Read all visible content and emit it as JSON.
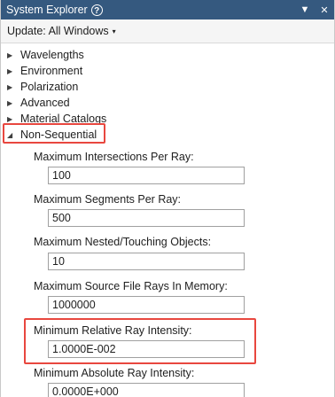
{
  "window": {
    "title": "System Explorer",
    "help_glyph": "?",
    "dropdown_glyph": "▼",
    "close_glyph": "✕"
  },
  "toolbar": {
    "update_label": "Update: All Windows",
    "caret": "▾"
  },
  "tree": {
    "collapsed_glyph": "▶",
    "expanded_glyph": "◢",
    "items": [
      {
        "label": "Wavelengths"
      },
      {
        "label": "Environment"
      },
      {
        "label": "Polarization"
      },
      {
        "label": "Advanced"
      },
      {
        "label": "Material Catalogs"
      }
    ],
    "expanded_item": {
      "label": "Non-Sequential"
    }
  },
  "non_sequential": {
    "fields": [
      {
        "label": "Maximum Intersections Per Ray:",
        "value": "100"
      },
      {
        "label": "Maximum Segments Per Ray:",
        "value": "500"
      },
      {
        "label": "Maximum Nested/Touching Objects:",
        "value": "10"
      },
      {
        "label": "Maximum Source File Rays In Memory:",
        "value": "1000000"
      },
      {
        "label": "Minimum Relative Ray Intensity:",
        "value": "1.0000E-002"
      },
      {
        "label": "Minimum Absolute Ray Intensity:",
        "value": "0.0000E+000"
      }
    ]
  },
  "colors": {
    "titlebar": "#35597f",
    "highlight": "#e8473f"
  }
}
